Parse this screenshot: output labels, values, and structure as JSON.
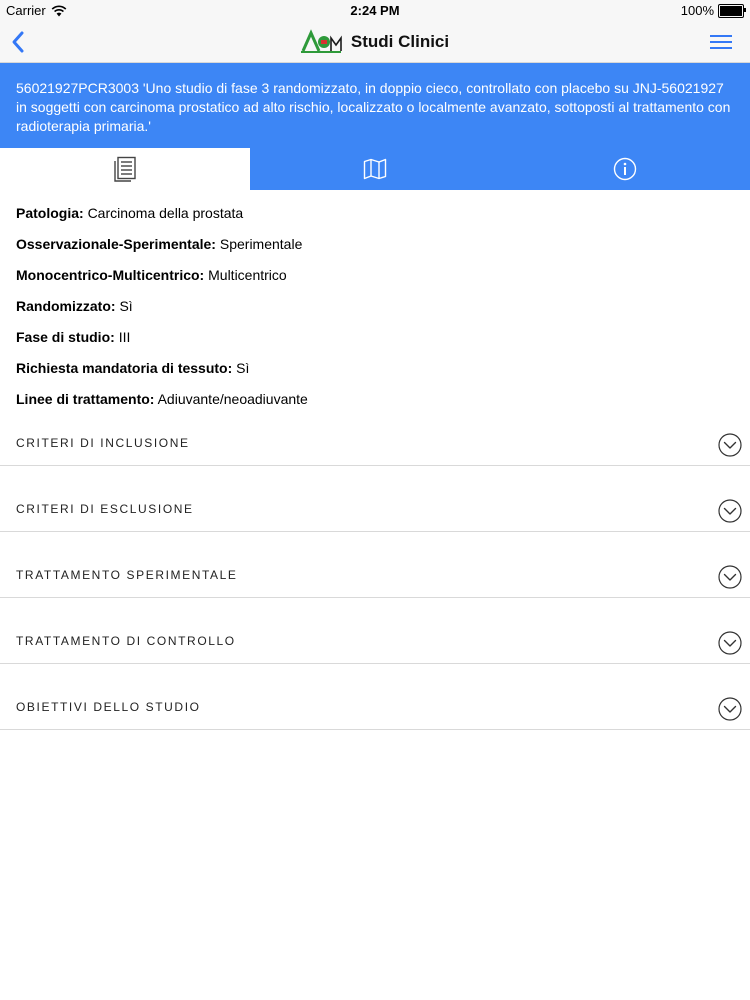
{
  "status_bar": {
    "carrier": "Carrier",
    "time": "2:24 PM",
    "battery": "100%",
    "battery_level": 1.0
  },
  "nav": {
    "back_icon": "chevron-left-icon",
    "logo_text": "AIOM",
    "title": "Studi Clinici",
    "menu_icon": "hamburger-menu-icon"
  },
  "study": {
    "title": "56021927PCR3003 'Uno studio di fase 3 randomizzato, in doppio cieco, controllato con placebo su JNJ-56021927 in soggetti con carcinoma prostatico ad alto rischio, localizzato o localmente avanzato, sottoposti al trattamento con radioterapia primaria.'"
  },
  "tabs": [
    {
      "icon": "document-list-icon",
      "active": true
    },
    {
      "icon": "map-icon",
      "active": false
    },
    {
      "icon": "info-icon",
      "active": false
    }
  ],
  "details": [
    {
      "label": "Patologia:",
      "value": "Carcinoma della prostata"
    },
    {
      "label": "Osservazionale-Sperimentale:",
      "value": "Sperimentale"
    },
    {
      "label": "Monocentrico-Multicentrico:",
      "value": "Multicentrico"
    },
    {
      "label": "Randomizzato:",
      "value": "Sì"
    },
    {
      "label": "Fase di studio:",
      "value": "III"
    },
    {
      "label": "Richiesta mandatoria di tessuto:",
      "value": "Sì"
    },
    {
      "label": "Linee di trattamento:",
      "value": "Adiuvante/neoadiuvante"
    }
  ],
  "sections": [
    {
      "label": "CRITERI DI INCLUSIONE"
    },
    {
      "label": "CRITERI DI ESCLUSIONE"
    },
    {
      "label": "TRATTAMENTO SPERIMENTALE"
    },
    {
      "label": "TRATTAMENTO DI CONTROLLO"
    },
    {
      "label": "OBIETTIVI DELLO STUDIO"
    }
  ],
  "colors": {
    "accent": "#3d86f5",
    "nav_bg": "#f7f7f7",
    "logo_green": "#2e9a3a",
    "logo_red": "#d8322f"
  }
}
